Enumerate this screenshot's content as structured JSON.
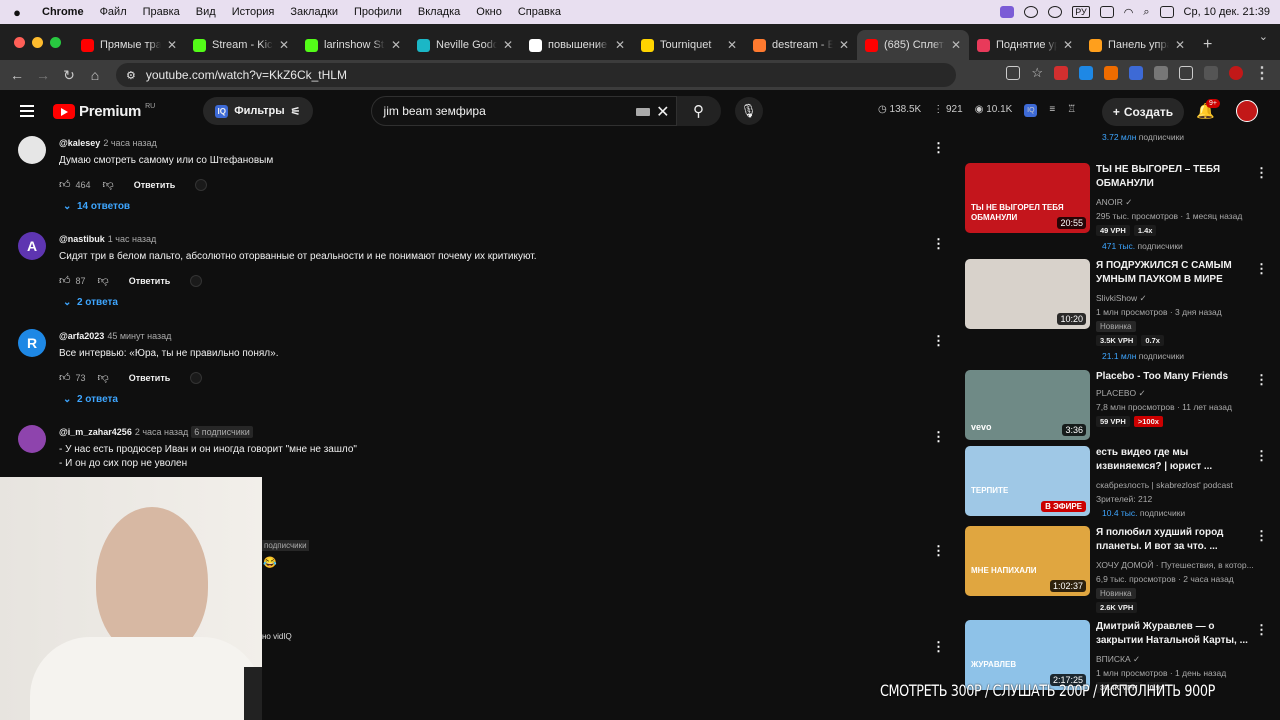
{
  "menubar": {
    "app": "Chrome",
    "items": [
      "Файл",
      "Правка",
      "Вид",
      "История",
      "Закладки",
      "Профили",
      "Вкладка",
      "Окно",
      "Справка"
    ],
    "lang": "РУ",
    "datetime": "Ср, 10 дек.  21:39"
  },
  "tabs": [
    {
      "label": "Прямые тран",
      "fav": "#ff0000"
    },
    {
      "label": "Stream - Kick",
      "fav": "#53fc18"
    },
    {
      "label": "larinshow Stre",
      "fav": "#53fc18"
    },
    {
      "label": "Neville Godda",
      "fav": "#1bb7c6"
    },
    {
      "label": "повышение ур",
      "fav": "#ffffff"
    },
    {
      "label": "Tourniquet",
      "fav": "#ffd400"
    },
    {
      "label": "destream - Ew",
      "fav": "#ff7a2f"
    },
    {
      "label": "(685) Сплетн",
      "fav": "#ff0000",
      "active": true
    },
    {
      "label": "Поднятие ур",
      "fav": "#e83a5a"
    },
    {
      "label": "Панель упра",
      "fav": "#ff9f1c"
    }
  ],
  "address": {
    "url": "youtube.com/watch?v=KkZ6Ck_tHLM"
  },
  "youtube": {
    "logo": "Premium",
    "region": "RU",
    "filters_label": "Фильтры",
    "search_value": "jim beam земфира",
    "stats": [
      "138.5K",
      "921",
      "10.1K"
    ],
    "create_label": "Создать",
    "notif_badge": "9+"
  },
  "comments": [
    {
      "author": "@kalesey",
      "time": "2 часа назад",
      "text": "Думаю смотреть самому или со Штефановым",
      "likes": "464",
      "reply": "Ответить",
      "replies": "14 ответов",
      "avatar_color": "#e6e6e6",
      "avatar_letter": ""
    },
    {
      "author": "@nastibuk",
      "time": "1 час назад",
      "text": "Сидят три в белом пальто, абсолютно оторванные от реальности и не понимают почему их критикуют.",
      "likes": "87",
      "reply": "Ответить",
      "replies": "2 ответа",
      "avatar_color": "#5e35b1",
      "avatar_letter": "A"
    },
    {
      "author": "@arfa2023",
      "time": "45 минут назад",
      "text": "Все интервью: «Юра, ты не правильно понял».",
      "likes": "73",
      "reply": "Ответить",
      "replies": "2 ответа",
      "avatar_color": "#1e88e5",
      "avatar_letter": "R"
    },
    {
      "author": "@i_m_zahar4256",
      "time": "2 часа назад",
      "subs": "6 подписчики",
      "text": "- У нас есть продюсер Иван и он иногда говорит \"мне не зашло\"",
      "text2": "- И он до сих пор не уволен",
      "avatar_color": "#8e44ad",
      "avatar_letter": ""
    }
  ],
  "partial_texts": {
    "subs_frag": "подписчики",
    "vidiq_frag": "но vidIQ"
  },
  "sidebar_top": {
    "subs": "3.72 млн",
    "subs_label": "подписчики"
  },
  "videos": [
    {
      "title": "ТЫ НЕ ВЫГОРЕЛ – ТЕБЯ ОБМАНУЛИ",
      "channel": "ANOIR",
      "verified": true,
      "views": "295 тыс. просмотров · 1 месяц назад",
      "vph": "49 VPH",
      "mult": "1.4x",
      "subs": "471 тыс.",
      "subs_label": "подписчики",
      "duration": "20:55",
      "thumb": "#c4151c",
      "thumb_text": "ТЫ НЕ ВЫГОРЕЛ ТЕБЯ ОБМАНУЛИ"
    },
    {
      "title": "Я ПОДРУЖИЛСЯ С САМЫМ УМНЫМ ПАУКОМ В МИРЕ",
      "channel": "SlivkiShow",
      "verified": true,
      "views": "1 млн просмотров · 3 дня назад",
      "badge": "Новинка",
      "vph": "3.5K VPH",
      "mult": "0.7x",
      "subs": "21.1 млн",
      "subs_label": "подписчики",
      "duration": "10:20",
      "thumb": "#d8d2cb",
      "thumb_text": ""
    },
    {
      "title": "Placebo - Too Many Friends",
      "channel": "PLACEBO",
      "verified": true,
      "views": "7,8 млн просмотров · 11 лет назад",
      "vph": "59 VPH",
      "mult": ">100x",
      "duration": "3:36",
      "thumb": "#6f8a86",
      "thumb_text": "vevo"
    },
    {
      "title": "есть видео где мы извиняемся? | юрист ...",
      "channel": "скабрезлость | skabrezlost' podcast",
      "verified": false,
      "views": "Зрителей: 212",
      "subs": "10.4 тыс.",
      "subs_label": "подписчики",
      "live": "В ЭФИРЕ",
      "thumb": "#9fc8e6",
      "thumb_text": "ТЕРПИТЕ"
    },
    {
      "title": "Я полюбил худший город планеты. И вот за что. ...",
      "channel": "ХОЧУ ДОМОЙ · Путешествия, в котор...",
      "verified": false,
      "views": "6,9 тыс. просмотров · 2 часа назад",
      "badge": "Новинка",
      "vph": "2.6K VPH",
      "duration": "1:02:37",
      "thumb": "#e0a640",
      "thumb_text": "МНЕ НАПИХАЛИ"
    },
    {
      "title": "Дмитрий Журавлев — о закрытии Натальной Карты, ...",
      "channel": "ВПИСКА",
      "verified": true,
      "views": "1 млн просмотров · 1 день назад",
      "vph": "30.4K VPH",
      "mult": "0.9x",
      "duration": "2:17:25",
      "thumb": "#8ec2e8",
      "thumb_text": "ЖУРАВЛЕВ"
    }
  ],
  "overlay_text": "СМОТРЕТЬ 300Р  /  СЛУШАТЬ 200Р  /  ИСПОЛНИТЬ  900Р"
}
